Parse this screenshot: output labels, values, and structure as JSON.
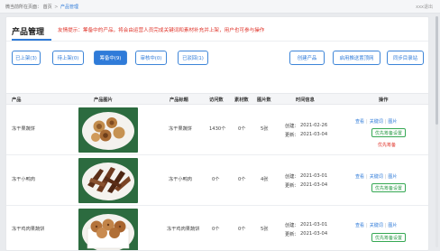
{
  "breadcrumb": {
    "left": "微当前所在页面：",
    "home": "首页",
    "sep": ">",
    "current": "产品管理",
    "right": "xxx退出"
  },
  "page": {
    "title": "产品管理",
    "notice": "友情提示：筹备中的产品，将会由运营人员完成关键词和素材补充并上架，用户也可参与操作"
  },
  "tabs": [
    {
      "label": "已上架(3)"
    },
    {
      "label": "待上架(0)"
    },
    {
      "label": "筹备中(9)"
    },
    {
      "label": "审核中(0)"
    },
    {
      "label": "已驳回(1)"
    }
  ],
  "actions": [
    {
      "label": "创建产品"
    },
    {
      "label": "启用推送置顶网"
    },
    {
      "label": "同步目录站"
    }
  ],
  "table": {
    "headers": [
      "产品",
      "产品图片",
      "产品标题",
      "访问数",
      "素材数",
      "图片数",
      "时间信息",
      "操作"
    ],
    "rows": [
      {
        "name": "冻干果蔬饼",
        "title": "冻干果蔬饼",
        "visits": "1430个",
        "materials": "0个",
        "images": "5张",
        "created_label": "创建：",
        "created": "2021-02-26",
        "updated_label": "更新：",
        "updated": "2021-03-04",
        "links": [
          "查看",
          "关键词",
          "图片"
        ],
        "btn": "优先筹备设置",
        "red": "优先筹备"
      },
      {
        "name": "冻干小鸭肉",
        "title": "冻干小鸭肉",
        "visits": "0个",
        "materials": "0个",
        "images": "4张",
        "created_label": "创建：",
        "created": "2021-03-01",
        "updated_label": "更新：",
        "updated": "2021-03-04",
        "links": [
          "查看",
          "关键词",
          "图片"
        ],
        "btn": "优先筹备设置",
        "red": ""
      },
      {
        "name": "冻干鸡肉果蔬饼",
        "title": "冻干鸡肉果蔬饼",
        "visits": "0个",
        "materials": "0个",
        "images": "5张",
        "created_label": "创建：",
        "created": "2021-03-01",
        "updated_label": "更新：",
        "updated": "2021-03-04",
        "links": [
          "查看",
          "关键词",
          "图片"
        ],
        "btn": "优先筹备设置",
        "red": ""
      }
    ]
  },
  "colors": {
    "accent": "#2f7bd9",
    "danger": "#e0352b",
    "success": "#35a853"
  }
}
